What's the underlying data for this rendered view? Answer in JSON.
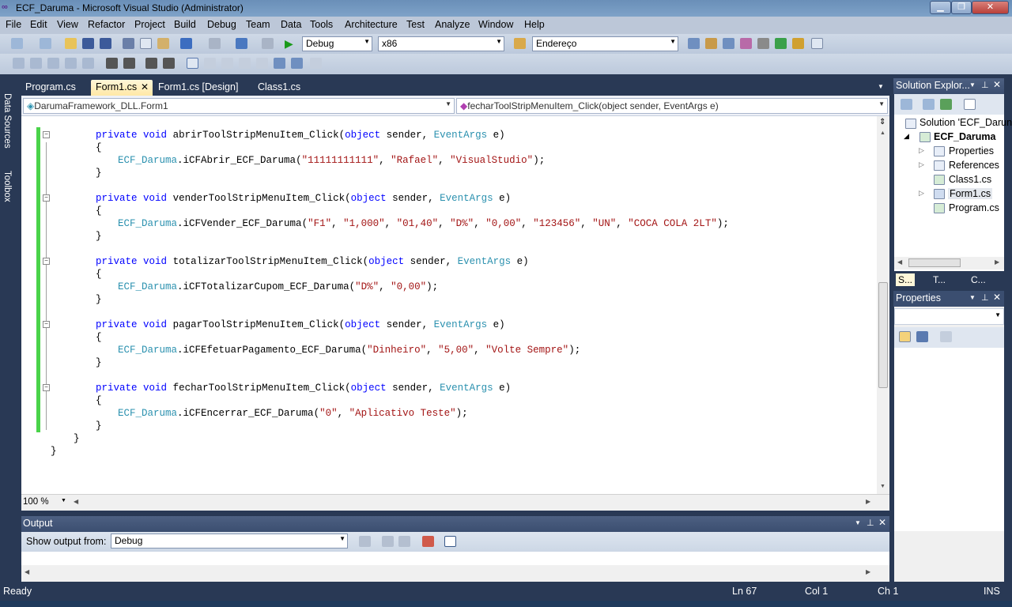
{
  "window": {
    "title": "ECF_Daruma - Microsoft Visual Studio (Administrator)"
  },
  "menu": [
    "File",
    "Edit",
    "View",
    "Refactor",
    "Project",
    "Build",
    "Debug",
    "Team",
    "Data",
    "Tools",
    "Architecture",
    "Test",
    "Analyze",
    "Window",
    "Help"
  ],
  "toolbar": {
    "config": "Debug",
    "platform": "x86",
    "find": "Endereço"
  },
  "side_tabs": {
    "data_sources": "Data Sources",
    "toolbox": "Toolbox"
  },
  "doc_tabs": [
    "Program.cs",
    "Form1.cs",
    "Form1.cs [Design]",
    "Class1.cs"
  ],
  "nav": {
    "class": "DarumaFramework_DLL.Form1",
    "member": "fecharToolStripMenuItem_Click(object sender, EventArgs e)"
  },
  "code": {
    "kw_private": "private",
    "kw_void": "void",
    "kw_object": "object",
    "ty_event": "EventArgs",
    "ty_ecf": "ECF_Daruma",
    "m1": {
      "name": "abrirToolStripMenuItem_Click",
      "call": "iCFAbrir_ECF_Daruma",
      "args": [
        "\"11111111111\"",
        "\"Rafael\"",
        "\"VisualStudio\""
      ]
    },
    "m2": {
      "name": "venderToolStripMenuItem_Click",
      "call": "iCFVender_ECF_Daruma",
      "args": [
        "\"F1\"",
        "\"1,000\"",
        "\"01,40\"",
        "\"D%\"",
        "\"0,00\"",
        "\"123456\"",
        "\"UN\"",
        "\"COCA COLA 2LT\""
      ]
    },
    "m3": {
      "name": "totalizarToolStripMenuItem_Click",
      "call": "iCFTotalizarCupom_ECF_Daruma",
      "args": [
        "\"D%\"",
        "\"0,00\""
      ]
    },
    "m4": {
      "name": "pagarToolStripMenuItem_Click",
      "call": "iCFEfetuarPagamento_ECF_Daruma",
      "args": [
        "\"Dinheiro\"",
        "\"5,00\"",
        "\"Volte Sempre\""
      ]
    },
    "m5": {
      "name": "fecharToolStripMenuItem_Click",
      "call": "iCFEncerrar_ECF_Daruma",
      "args": [
        "\"0\"",
        "\"Aplicativo Teste\""
      ]
    }
  },
  "zoom": "100 %",
  "output": {
    "title": "Output",
    "show_from_label": "Show output from:",
    "source": "Debug"
  },
  "solution_explorer": {
    "title": "Solution Explor...",
    "solution": "Solution 'ECF_Darun",
    "project": "ECF_Daruma",
    "items": [
      "Properties",
      "References",
      "Class1.cs",
      "Form1.cs",
      "Program.cs"
    ],
    "bottom_tabs": [
      "S...",
      "T...",
      "C..."
    ]
  },
  "properties": {
    "title": "Properties"
  },
  "status": {
    "left": "Ready",
    "ln": "Ln 67",
    "col": "Col 1",
    "ch": "Ch 1",
    "mode": "INS"
  }
}
